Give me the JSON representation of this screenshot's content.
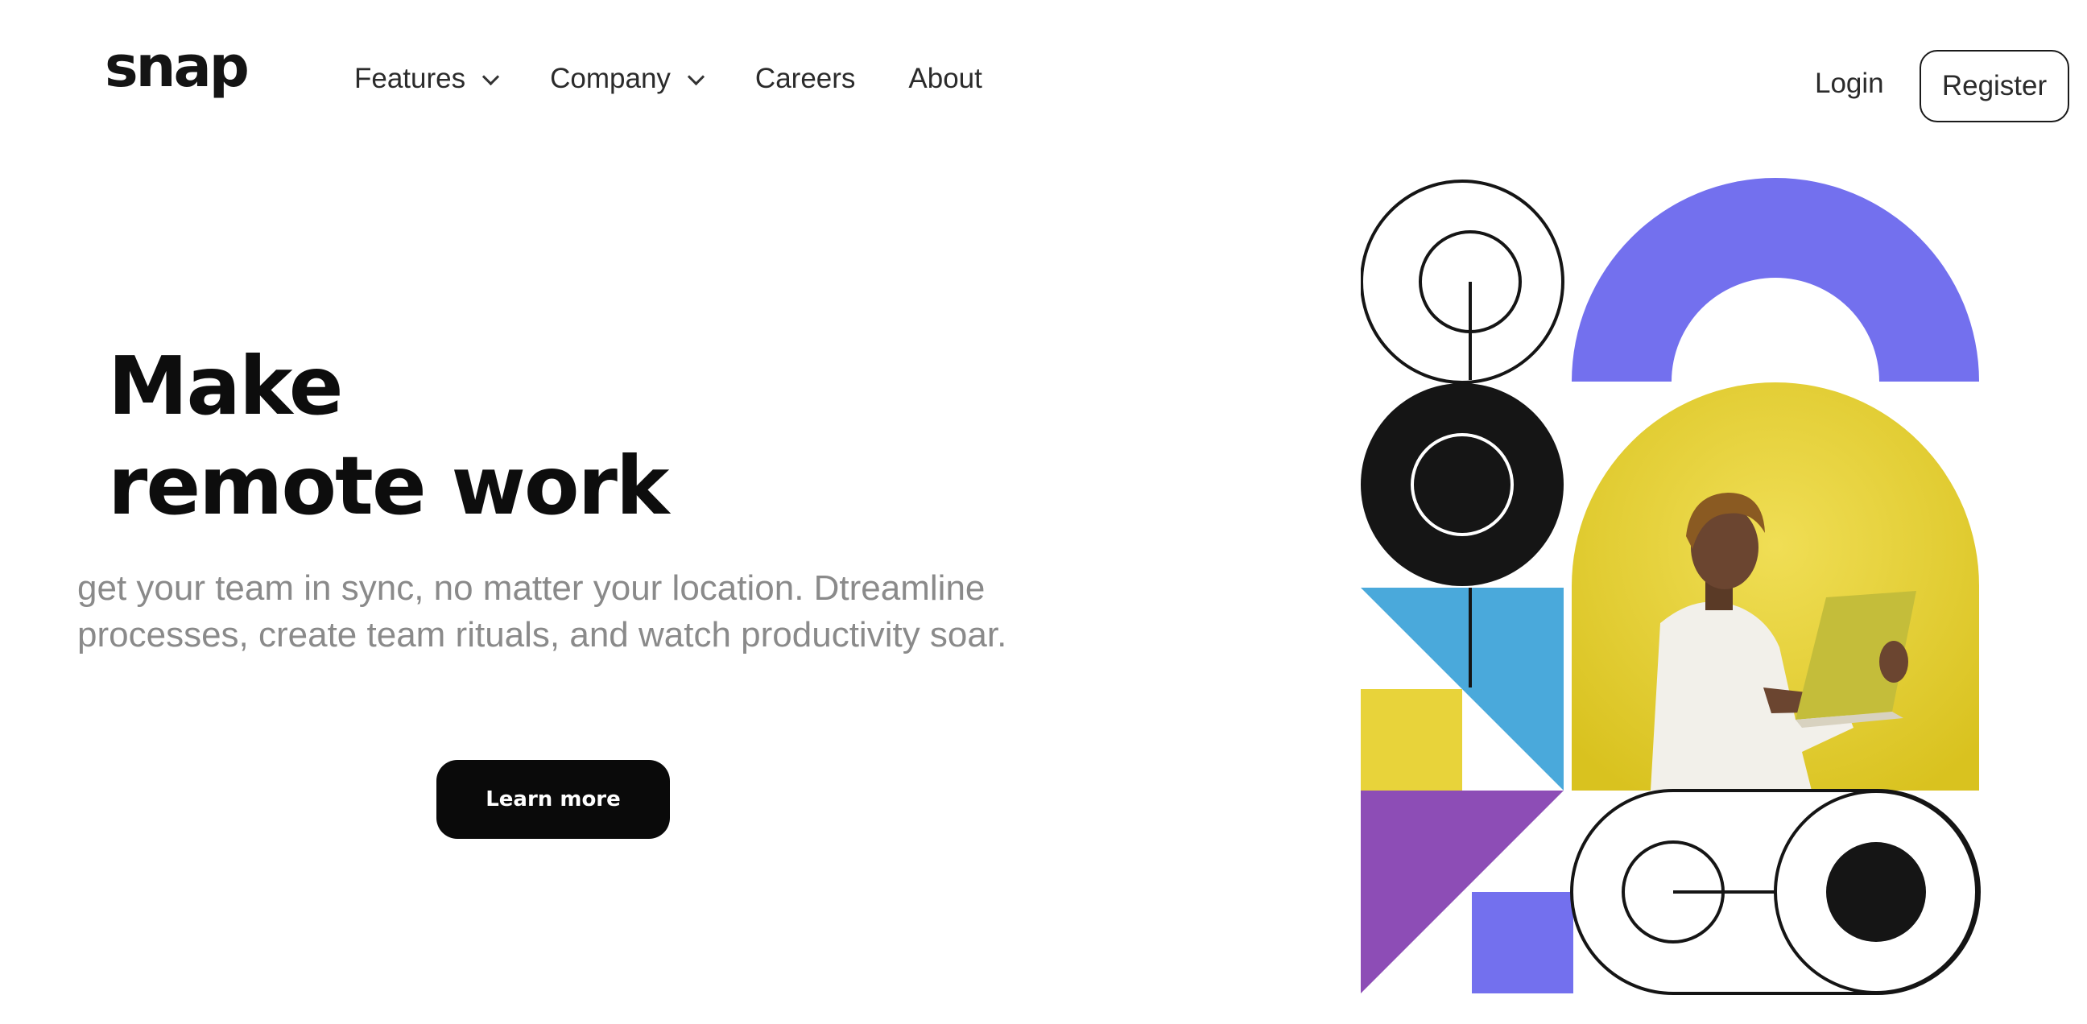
{
  "brand": {
    "name": "snap"
  },
  "nav": {
    "items": [
      {
        "label": "Features",
        "has_dropdown": true
      },
      {
        "label": "Company",
        "has_dropdown": true
      },
      {
        "label": "Careers",
        "has_dropdown": false
      },
      {
        "label": "About",
        "has_dropdown": false
      }
    ]
  },
  "auth": {
    "login_label": "Login",
    "register_label": "Register"
  },
  "hero": {
    "title_line1": "Make",
    "title_line2": "remote work",
    "description": "get your team in sync, no matter your location. Dtreamline processes, create team rituals, and watch productivity soar.",
    "cta_label": "Learn more"
  },
  "illustration": {
    "colors": {
      "purple": "#7370ee",
      "yellow": "#e8d33a",
      "blue": "#4aa9db",
      "violet": "#8d4db6",
      "black": "#151515"
    },
    "icons": [
      "person-with-laptop-photo",
      "geometric-shapes"
    ]
  }
}
